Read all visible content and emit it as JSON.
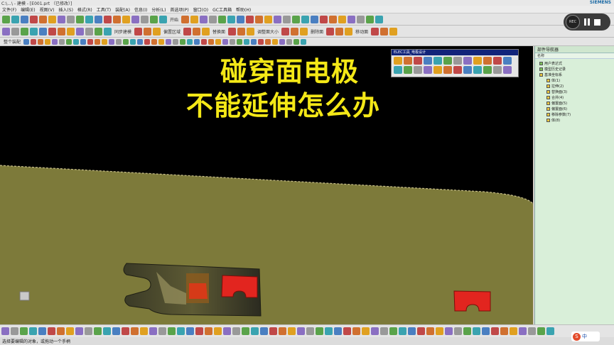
{
  "window": {
    "title": "C:\\...\\ - 建模 - [E001.prt （已修改）]",
    "brand": "SIEMENS"
  },
  "menus": [
    "文件(F)",
    "编辑(E)",
    "视图(V)",
    "插入(S)",
    "格式(R)",
    "工具(T)",
    "装配(A)",
    "信息(I)",
    "分析(L)",
    "首选项(P)",
    "窗口(O)",
    "GC工具箱",
    "帮助(H)"
  ],
  "toolbar": {
    "labels": [
      "开始",
      "同步建模",
      "偏置区域",
      "替换面",
      "调整面大小",
      "删除面",
      "移动面"
    ],
    "filter_label": "整个装配"
  },
  "caption": {
    "line1": "碰穿面电极",
    "line2": "不能延伸怎么办"
  },
  "electrode_toolbar": {
    "title": "ELEC工具_电极设计"
  },
  "navigator": {
    "title": "部件导航器",
    "column": "名称",
    "items": [
      {
        "label": "用户表达式",
        "icon": "g"
      },
      {
        "label": "模型历史记录",
        "icon": "g"
      },
      {
        "label": "基准坐标系",
        "icon": "y"
      },
      {
        "label": "体(1)",
        "icon": "y"
      },
      {
        "label": "拉伸(2)",
        "icon": "y"
      },
      {
        "label": "替换面(3)",
        "icon": "y"
      },
      {
        "label": "合并(4)",
        "icon": "y"
      },
      {
        "label": "偏置面(5)",
        "icon": "y"
      },
      {
        "label": "偏置面(6)",
        "icon": "y"
      },
      {
        "label": "移除参数(7)",
        "icon": "y"
      },
      {
        "label": "体(8)",
        "icon": "y"
      }
    ]
  },
  "status": {
    "text": "选择要编辑的对象，或拖动一个手柄"
  },
  "ime": {
    "lang": "中"
  },
  "colors": {
    "part": "#7d7a3a",
    "electrode": "#e2251f",
    "caption": "#f4e817",
    "navigator": "#d9efd9"
  }
}
